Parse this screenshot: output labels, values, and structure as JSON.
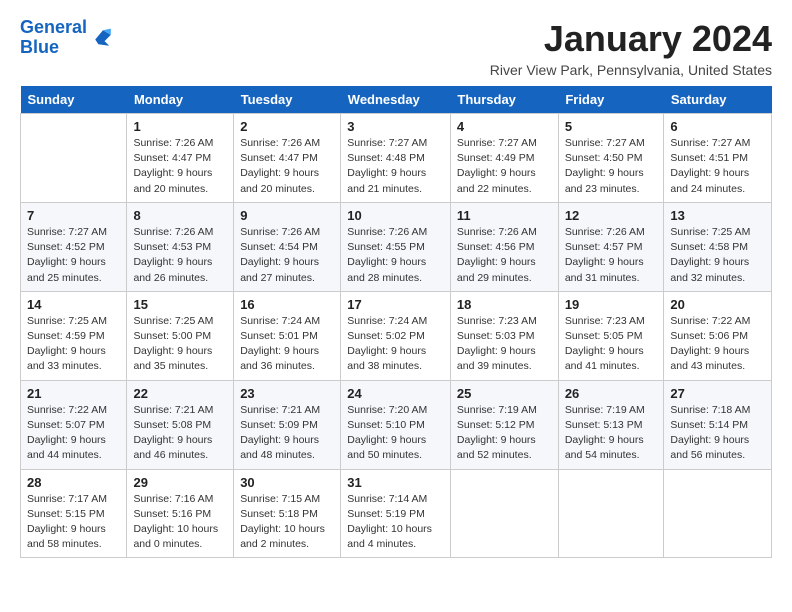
{
  "header": {
    "logo_line1": "General",
    "logo_line2": "Blue",
    "month_title": "January 2024",
    "subtitle": "River View Park, Pennsylvania, United States"
  },
  "weekdays": [
    "Sunday",
    "Monday",
    "Tuesday",
    "Wednesday",
    "Thursday",
    "Friday",
    "Saturday"
  ],
  "weeks": [
    [
      {
        "num": "",
        "detail": ""
      },
      {
        "num": "1",
        "detail": "Sunrise: 7:26 AM\nSunset: 4:47 PM\nDaylight: 9 hours\nand 20 minutes."
      },
      {
        "num": "2",
        "detail": "Sunrise: 7:26 AM\nSunset: 4:47 PM\nDaylight: 9 hours\nand 20 minutes."
      },
      {
        "num": "3",
        "detail": "Sunrise: 7:27 AM\nSunset: 4:48 PM\nDaylight: 9 hours\nand 21 minutes."
      },
      {
        "num": "4",
        "detail": "Sunrise: 7:27 AM\nSunset: 4:49 PM\nDaylight: 9 hours\nand 22 minutes."
      },
      {
        "num": "5",
        "detail": "Sunrise: 7:27 AM\nSunset: 4:50 PM\nDaylight: 9 hours\nand 23 minutes."
      },
      {
        "num": "6",
        "detail": "Sunrise: 7:27 AM\nSunset: 4:51 PM\nDaylight: 9 hours\nand 24 minutes."
      }
    ],
    [
      {
        "num": "7",
        "detail": "Sunrise: 7:27 AM\nSunset: 4:52 PM\nDaylight: 9 hours\nand 25 minutes."
      },
      {
        "num": "8",
        "detail": "Sunrise: 7:26 AM\nSunset: 4:53 PM\nDaylight: 9 hours\nand 26 minutes."
      },
      {
        "num": "9",
        "detail": "Sunrise: 7:26 AM\nSunset: 4:54 PM\nDaylight: 9 hours\nand 27 minutes."
      },
      {
        "num": "10",
        "detail": "Sunrise: 7:26 AM\nSunset: 4:55 PM\nDaylight: 9 hours\nand 28 minutes."
      },
      {
        "num": "11",
        "detail": "Sunrise: 7:26 AM\nSunset: 4:56 PM\nDaylight: 9 hours\nand 29 minutes."
      },
      {
        "num": "12",
        "detail": "Sunrise: 7:26 AM\nSunset: 4:57 PM\nDaylight: 9 hours\nand 31 minutes."
      },
      {
        "num": "13",
        "detail": "Sunrise: 7:25 AM\nSunset: 4:58 PM\nDaylight: 9 hours\nand 32 minutes."
      }
    ],
    [
      {
        "num": "14",
        "detail": "Sunrise: 7:25 AM\nSunset: 4:59 PM\nDaylight: 9 hours\nand 33 minutes."
      },
      {
        "num": "15",
        "detail": "Sunrise: 7:25 AM\nSunset: 5:00 PM\nDaylight: 9 hours\nand 35 minutes."
      },
      {
        "num": "16",
        "detail": "Sunrise: 7:24 AM\nSunset: 5:01 PM\nDaylight: 9 hours\nand 36 minutes."
      },
      {
        "num": "17",
        "detail": "Sunrise: 7:24 AM\nSunset: 5:02 PM\nDaylight: 9 hours\nand 38 minutes."
      },
      {
        "num": "18",
        "detail": "Sunrise: 7:23 AM\nSunset: 5:03 PM\nDaylight: 9 hours\nand 39 minutes."
      },
      {
        "num": "19",
        "detail": "Sunrise: 7:23 AM\nSunset: 5:05 PM\nDaylight: 9 hours\nand 41 minutes."
      },
      {
        "num": "20",
        "detail": "Sunrise: 7:22 AM\nSunset: 5:06 PM\nDaylight: 9 hours\nand 43 minutes."
      }
    ],
    [
      {
        "num": "21",
        "detail": "Sunrise: 7:22 AM\nSunset: 5:07 PM\nDaylight: 9 hours\nand 44 minutes."
      },
      {
        "num": "22",
        "detail": "Sunrise: 7:21 AM\nSunset: 5:08 PM\nDaylight: 9 hours\nand 46 minutes."
      },
      {
        "num": "23",
        "detail": "Sunrise: 7:21 AM\nSunset: 5:09 PM\nDaylight: 9 hours\nand 48 minutes."
      },
      {
        "num": "24",
        "detail": "Sunrise: 7:20 AM\nSunset: 5:10 PM\nDaylight: 9 hours\nand 50 minutes."
      },
      {
        "num": "25",
        "detail": "Sunrise: 7:19 AM\nSunset: 5:12 PM\nDaylight: 9 hours\nand 52 minutes."
      },
      {
        "num": "26",
        "detail": "Sunrise: 7:19 AM\nSunset: 5:13 PM\nDaylight: 9 hours\nand 54 minutes."
      },
      {
        "num": "27",
        "detail": "Sunrise: 7:18 AM\nSunset: 5:14 PM\nDaylight: 9 hours\nand 56 minutes."
      }
    ],
    [
      {
        "num": "28",
        "detail": "Sunrise: 7:17 AM\nSunset: 5:15 PM\nDaylight: 9 hours\nand 58 minutes."
      },
      {
        "num": "29",
        "detail": "Sunrise: 7:16 AM\nSunset: 5:16 PM\nDaylight: 10 hours\nand 0 minutes."
      },
      {
        "num": "30",
        "detail": "Sunrise: 7:15 AM\nSunset: 5:18 PM\nDaylight: 10 hours\nand 2 minutes."
      },
      {
        "num": "31",
        "detail": "Sunrise: 7:14 AM\nSunset: 5:19 PM\nDaylight: 10 hours\nand 4 minutes."
      },
      {
        "num": "",
        "detail": ""
      },
      {
        "num": "",
        "detail": ""
      },
      {
        "num": "",
        "detail": ""
      }
    ]
  ]
}
